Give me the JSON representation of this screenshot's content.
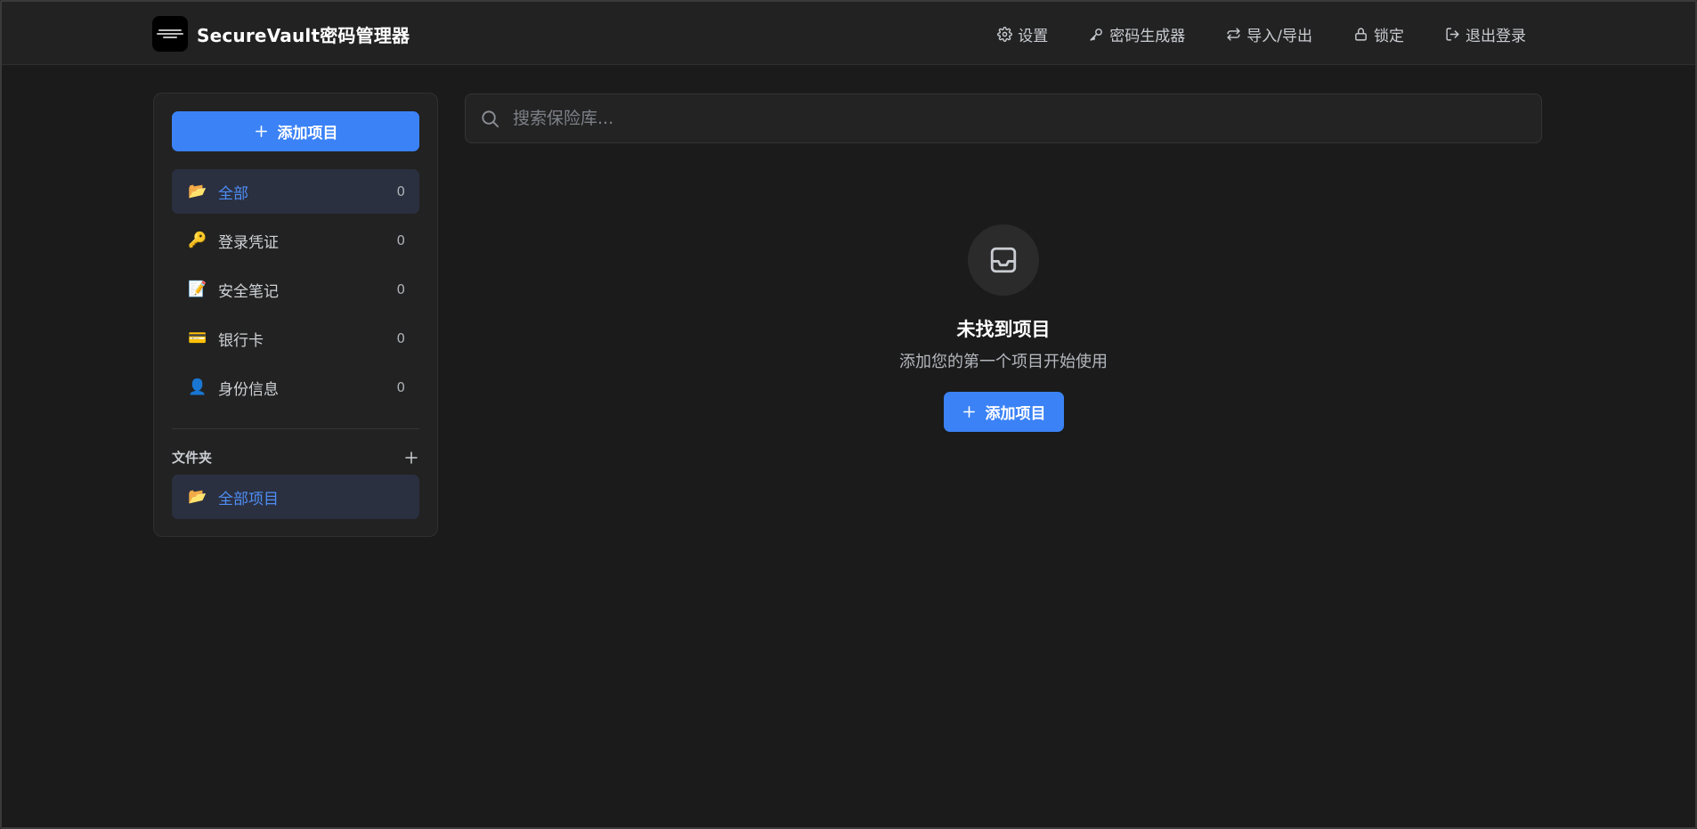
{
  "app": {
    "title": "SecureVault密码管理器"
  },
  "nav": {
    "settings": "设置",
    "generator": "密码生成器",
    "import_export": "导入/导出",
    "lock": "锁定",
    "logout": "退出登录"
  },
  "sidebar": {
    "add_label": "添加项目",
    "categories": [
      {
        "label": "全部",
        "count": "0",
        "icon": "folder-icon",
        "active": true
      },
      {
        "label": "登录凭证",
        "count": "0",
        "icon": "key-icon"
      },
      {
        "label": "安全笔记",
        "count": "0",
        "icon": "note-icon"
      },
      {
        "label": "银行卡",
        "count": "0",
        "icon": "credit-card-icon"
      },
      {
        "label": "身份信息",
        "count": "0",
        "icon": "identity-icon"
      }
    ],
    "folders_title": "文件夹",
    "folders": [
      {
        "label": "全部项目",
        "icon": "folder-icon",
        "active": true
      }
    ]
  },
  "search": {
    "placeholder": "搜索保险库..."
  },
  "empty_state": {
    "title": "未找到项目",
    "subtitle": "添加您的第一个项目开始使用",
    "button_label": "添加项目"
  },
  "colors": {
    "accent": "#3b82f6",
    "active_text": "#4f8df5",
    "background": "#1b1b1b",
    "panel": "#222222"
  }
}
